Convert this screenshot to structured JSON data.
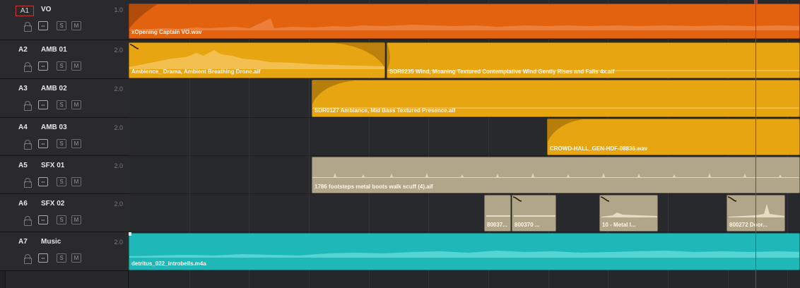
{
  "tracks": [
    {
      "id": "A1",
      "name": "VO",
      "level": "1.0"
    },
    {
      "id": "A2",
      "name": "AMB 01",
      "level": "2.0"
    },
    {
      "id": "A3",
      "name": "AMB 02",
      "level": "2.0"
    },
    {
      "id": "A4",
      "name": "AMB 03",
      "level": "2.0"
    },
    {
      "id": "A5",
      "name": "SFX 01",
      "level": "2.0"
    },
    {
      "id": "A6",
      "name": "SFX 02",
      "level": "2.0"
    },
    {
      "id": "A7",
      "name": "Music",
      "level": "2.0"
    }
  ],
  "controls": {
    "link": "⇔",
    "solo": "S",
    "mute": "M"
  },
  "clips": {
    "vo": "xOpening Captain VO.wav",
    "amb1a": "Ambience_ Drama, Ambient Breathing Drone.aif",
    "amb1b": "SDR0235 Wind, Moaning Textured Contemplative Wind Gently Rises and Falls 4x.aif",
    "amb2": "SDR0127 Ambiance, Mid Bass Textured Presence.aif",
    "amb3": "CROWD-HALL_GEN-HDF-08836.wav",
    "sfx1": "1786 footsteps metal boots walk scuff (4).aif",
    "sfx2a": "80037...",
    "sfx2b": "800370 ...",
    "sfx2c": "10 - Metal I...",
    "sfx2d": "800272 Door...",
    "music": "detritus_022_introbells.m4a"
  },
  "colors": {
    "vo": "#e3620f",
    "amb": "#e8a512",
    "sfx": "#b1a58a",
    "music": "#1fb8b8",
    "playhead": "#9b3a3a"
  },
  "icons": [
    "lock-icon",
    "link-icon",
    "solo-button",
    "mute-button",
    "crossfade-icon"
  ]
}
